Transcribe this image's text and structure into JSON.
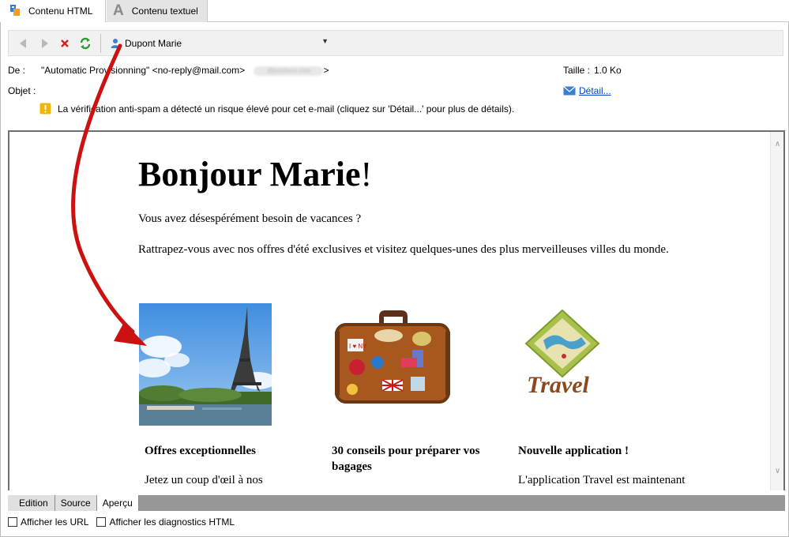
{
  "tabs": [
    {
      "label": "Contenu HTML",
      "active": true
    },
    {
      "label": "Contenu textuel",
      "active": false
    }
  ],
  "toolbar": {
    "recipient": "Dupont Marie"
  },
  "headers": {
    "from_label": "De :",
    "from_value": "\"Automatic Provisionning\" <no-reply@mail.com>",
    "blurred_address": "@jonckers.com",
    "from_suffix": ">",
    "subject_label": "Objet :",
    "size_label": "Taille :",
    "size_value": "1.0 Ko",
    "detail_link": "Détail...",
    "spam_warning": "La vérification anti-spam a détecté un risque élevé pour cet e-mail (cliquez sur 'Détail...' pour plus de détails)."
  },
  "email": {
    "greeting_bold": "Bonjour Marie",
    "greeting_tail": "!",
    "line1": "Vous avez désespérément besoin de vacances ?",
    "line2": "Rattrapez-vous avec nos offres d'été exclusives et visitez quelques-unes des plus merveilleuses villes du monde.",
    "cards": [
      {
        "title": "Offres exceptionnelles",
        "text": "Jetez un coup d'œil à nos"
      },
      {
        "title": "30 conseils pour préparer vos bagages",
        "text": ""
      },
      {
        "title": "Nouvelle application !",
        "text": "L'application Travel est maintenant"
      }
    ],
    "travel_logo_text": "Travel",
    "suitcase_sticker_text": "I ♥ NY"
  },
  "bottom_tabs": [
    {
      "label": "Edition",
      "active": false
    },
    {
      "label": "Source",
      "active": false
    },
    {
      "label": "Aperçu",
      "active": true
    }
  ],
  "options": [
    {
      "label": "Afficher les URL",
      "checked": false
    },
    {
      "label": "Afficher les diagnostics HTML",
      "checked": false
    }
  ],
  "colors": {
    "annotation_arrow": "#cc1111",
    "link": "#0044cc",
    "warning": "#f2b600"
  }
}
